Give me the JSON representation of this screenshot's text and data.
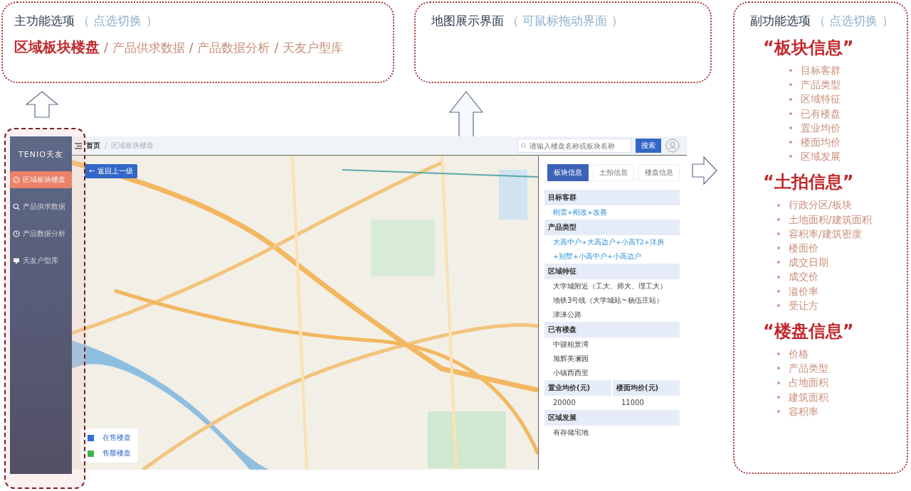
{
  "main_callout": {
    "title": "主功能选项",
    "hint": "（ 点选切换 ）",
    "options": [
      {
        "label": "区域板块楼盘",
        "selected": true
      },
      {
        "label": "产品供求数据",
        "selected": false
      },
      {
        "label": "产品数据分析",
        "selected": false
      },
      {
        "label": "天友户型库",
        "selected": false
      }
    ],
    "separator": "/"
  },
  "map_callout": {
    "title": "地图展示界面",
    "hint": "（ 可鼠标拖动界面 ）"
  },
  "side_callout": {
    "title": "副功能选项",
    "hint": "（ 点选切换 ）",
    "groups": [
      {
        "heading": "“板块信息”",
        "items": [
          "目标客群",
          "产品类型",
          "区域特征",
          "已有楼盘",
          "置业均价",
          "楼面均价",
          "区域发展"
        ]
      },
      {
        "heading": "“土拍信息”",
        "items": [
          "行政分区/板块",
          "土地面积/建筑面积",
          "容积率/建筑密度",
          "楼面价",
          "成交日期",
          "成交价",
          "溢价率",
          "受让方"
        ]
      },
      {
        "heading": "“楼盘信息”",
        "items": [
          "价格",
          "产品类型",
          "占地面积",
          "建筑面积",
          "容积率"
        ]
      }
    ]
  },
  "app": {
    "logo": "TENIO天友",
    "nav": [
      {
        "label": "区域板块楼盘",
        "selected": true
      },
      {
        "label": "产品供求数据",
        "selected": false
      },
      {
        "label": "产品数据分析",
        "selected": false
      },
      {
        "label": "天友户型库",
        "selected": false
      }
    ],
    "breadcrumb": [
      "首页",
      "区域板块楼盘"
    ],
    "breadcrumb_separator": "/",
    "search": {
      "placeholder": "请输入楼盘名称或板块名称"
    },
    "search_button": "搜索",
    "back_button": "← 返回上一级",
    "legend": [
      {
        "label": "在售楼盘",
        "color": "#2f6fd6"
      },
      {
        "label": "售罄楼盘",
        "color": "#3bb54a"
      }
    ],
    "tabs": [
      {
        "label": "板块信息",
        "selected": true
      },
      {
        "label": "土拍信息",
        "selected": false
      },
      {
        "label": "楼盘信息",
        "selected": false
      }
    ],
    "sections": [
      {
        "kind": "list",
        "heading": "目标客群",
        "accent": true,
        "lines": [
          "刚需+刚改+改善"
        ]
      },
      {
        "kind": "list",
        "heading": "产品类型",
        "accent": true,
        "lines": [
          "大高中户+大高边户+小高T2+洋房",
          "+别墅+小高中户+小高边户"
        ]
      },
      {
        "kind": "list",
        "heading": "区域特征",
        "accent": false,
        "lines": [
          "大学城附近（工大、师大、理工大）",
          "地铁3号线（大学城站~杨伍庄站）",
          "津涞公路"
        ]
      },
      {
        "kind": "list",
        "heading": "已有楼盘",
        "accent": false,
        "lines": [
          "中骏柏景湾",
          "旭辉美澜园",
          "小镇西西里"
        ]
      },
      {
        "kind": "pair",
        "headings": [
          "置业均价(元)",
          "楼面均价(元)"
        ],
        "values": [
          "20000",
          "11000"
        ]
      },
      {
        "kind": "list",
        "heading": "区域发展",
        "accent": false,
        "lines": [
          "有存储宅地"
        ]
      }
    ]
  }
}
